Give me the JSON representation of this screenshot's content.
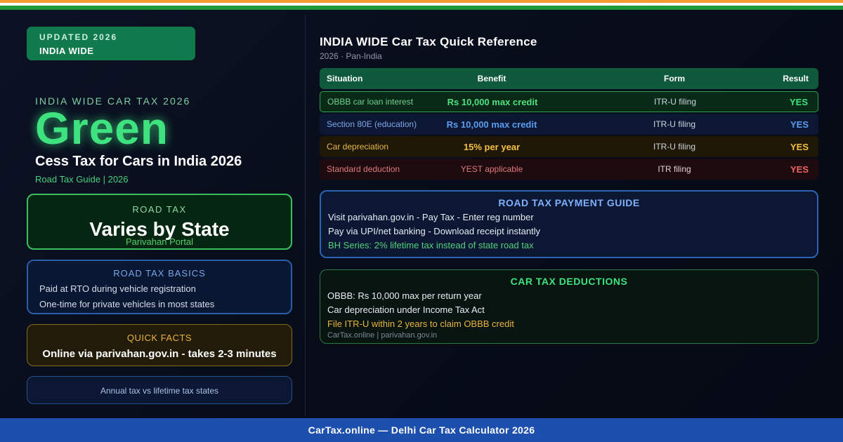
{
  "colors": {
    "saffron": "#f39a2e",
    "white": "#ffffff",
    "green": "#1f9a3a",
    "accent_green": "#3ee27f",
    "footer_blue": "#1d4fad"
  },
  "badge": {
    "line1": "UPDATED 2026",
    "line2": "INDIA WIDE"
  },
  "hero": {
    "kicker": "INDIA WIDE CAR TAX 2026",
    "big": "Green",
    "title": "Cess Tax for Cars in India 2026",
    "subtitle": "Road Tax Guide | 2026"
  },
  "road_tax": {
    "label": "ROAD TAX",
    "value": "Varies by State",
    "source": "Parivahan Portal"
  },
  "basics": {
    "heading": "ROAD TAX BASICS",
    "lines": [
      "Paid at RTO during vehicle registration",
      "One-time for private vehicles in most states"
    ]
  },
  "quick_facts": {
    "heading": "QUICK FACTS",
    "value": "Online via parivahan.gov.in - takes 2-3 minutes"
  },
  "annual_note": "Annual tax vs lifetime tax states",
  "reference": {
    "title": "INDIA WIDE Car Tax Quick Reference",
    "subtitle": "2026 · Pan-India",
    "headers": {
      "situation": "Situation",
      "benefit": "Benefit",
      "form": "Form",
      "result": "Result"
    },
    "rows": [
      {
        "situation": "OBBB car loan interest",
        "benefit": "Rs 10,000 max credit",
        "form": "ITR-U filing",
        "result": "YES"
      },
      {
        "situation": "Section 80E (education)",
        "benefit": "Rs 10,000 max credit",
        "form": "ITR-U filing",
        "result": "YES"
      },
      {
        "situation": "Car depreciation",
        "benefit": "15% per year",
        "form": "ITR-U filing",
        "result": "YES"
      },
      {
        "situation": "Standard deduction",
        "benefit": "YEST applicable",
        "form": "ITR filing",
        "result": "YES"
      }
    ]
  },
  "payment_guide": {
    "heading": "ROAD TAX PAYMENT GUIDE",
    "lines": [
      "Visit parivahan.gov.in - Pay Tax - Enter reg number",
      "Pay via UPI/net banking - Download receipt instantly",
      "BH Series: 2% lifetime tax instead of state road tax"
    ]
  },
  "deductions": {
    "heading": "CAR TAX DEDUCTIONS",
    "lines": [
      "OBBB: Rs 10,000 max per return year",
      "Car depreciation under Income Tax Act",
      "File ITR-U within 2 years to claim OBBB credit"
    ],
    "source": "CarTax.online | parivahan.gov.in"
  },
  "footer": "CarTax.online — Delhi Car Tax Calculator 2026"
}
